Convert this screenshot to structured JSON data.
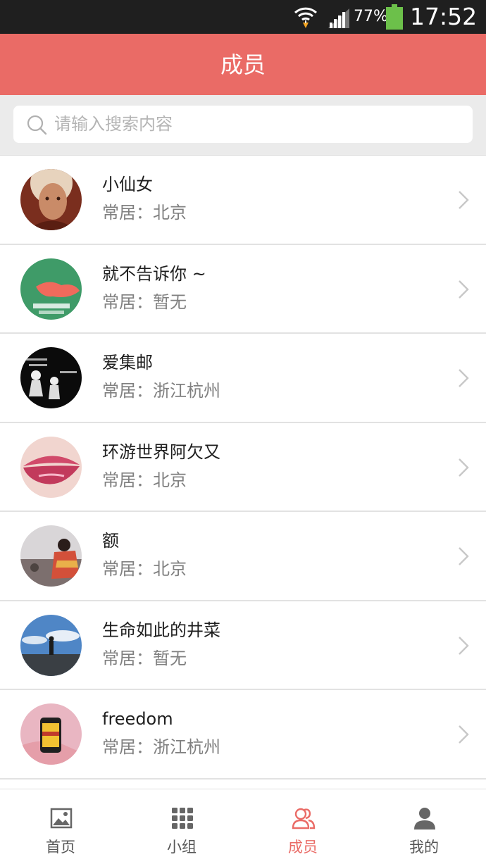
{
  "status_bar": {
    "battery_percent": "77%",
    "time": "17:52"
  },
  "header": {
    "title": "成员"
  },
  "search": {
    "placeholder": "请输入搜索内容"
  },
  "members": [
    {
      "name": "小仙女",
      "location": "常居：北京"
    },
    {
      "name": "就不告诉你 ~",
      "location": "常居：暂无"
    },
    {
      "name": "爱集邮",
      "location": "常居：浙江杭州"
    },
    {
      "name": "环游世界阿欠又",
      "location": "常居：北京"
    },
    {
      "name": "额",
      "location": "常居：北京"
    },
    {
      "name": "生命如此的井菜",
      "location": "常居：暂无"
    },
    {
      "name": "freedom",
      "location": "常居：浙江杭州"
    }
  ],
  "tabbar": {
    "items": [
      {
        "label": "首页",
        "icon": "image-icon"
      },
      {
        "label": "小组",
        "icon": "grid-icon"
      },
      {
        "label": "成员",
        "icon": "members-icon"
      },
      {
        "label": "我的",
        "icon": "person-icon"
      }
    ],
    "active": "成员"
  },
  "colors": {
    "accent": "#ea6b66",
    "status_bar": "#1f1f1f",
    "battery": "#6cc04a"
  }
}
